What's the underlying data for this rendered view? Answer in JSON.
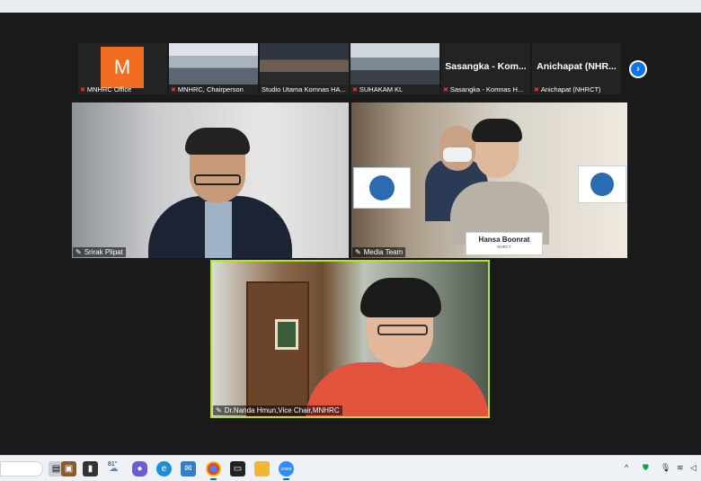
{
  "filmstrip": {
    "tiles": [
      {
        "name": "MNHRC Office",
        "avatar_letter": "M"
      },
      {
        "name": "MNHRC, Chairperson"
      },
      {
        "name": "Studio Utama Komnas HA..."
      },
      {
        "name": "SUHAKAM KL"
      },
      {
        "name": "Sasangka - Komnas H...",
        "big": "Sasangka - Kom..."
      },
      {
        "name": "Anichapat (NHRCT)",
        "big": "Anichapat (NHR..."
      }
    ],
    "next_icon": "chevron-right-icon",
    "next_glyph": "›"
  },
  "main": {
    "tiles": [
      {
        "name": "Srirak Plipat"
      },
      {
        "name": "Media Team",
        "nameplate_name": "Hansa Boonrat",
        "nameplate_org": "NHRCT"
      },
      {
        "name": "Dr.Nanda Hmun,Vice Chair,MNHRC"
      }
    ]
  },
  "taskbar": {
    "temperature": "81°"
  },
  "colors": {
    "active_speaker_border": "#b5e61d",
    "zoom_blue": "#0e72ed",
    "avatar_orange": "#f26d22"
  }
}
